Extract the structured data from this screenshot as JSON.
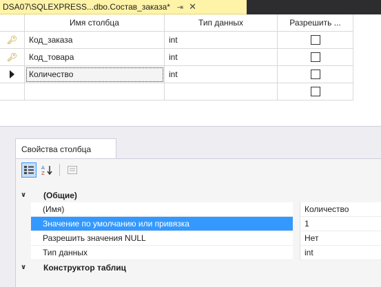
{
  "document_tab": {
    "title": "DSA07\\SQLEXPRESS...dbo.Состав_заказа*",
    "pin_icon": "pin-icon",
    "close_icon": "close-icon"
  },
  "grid": {
    "columns": [
      "Имя столбца",
      "Тип данных",
      "Разрешить ..."
    ],
    "rows": [
      {
        "indicator": "key-icon",
        "name": "Код_заказа",
        "type": "int",
        "allow_null": false
      },
      {
        "indicator": "key-icon",
        "name": "Код_товара",
        "type": "int",
        "allow_null": false
      },
      {
        "indicator": "current-row-arrow-icon",
        "name": "Количество",
        "type": "int",
        "allow_null": false
      },
      {
        "indicator": "",
        "name": "",
        "type": "",
        "allow_null": false
      }
    ]
  },
  "properties": {
    "tab_label": "Свойства столбца",
    "toolbar": [
      "categorized-icon",
      "alphabetical-icon",
      "property-pages-icon"
    ],
    "groups": [
      {
        "name": "(Общие)",
        "expanded": true,
        "items": [
          {
            "name": "(Имя)",
            "value": "Количество"
          },
          {
            "name": "Значение по умолчанию или привязка",
            "value": "1",
            "selected": true
          },
          {
            "name": "Разрешить значения NULL",
            "value": "Нет"
          },
          {
            "name": "Тип данных",
            "value": "int"
          }
        ]
      },
      {
        "name": "Конструктор таблиц",
        "expanded": true,
        "items": []
      }
    ]
  },
  "colors": {
    "tab_background": "#fff3a8",
    "selection": "#3399ff",
    "key": "#b48a00"
  }
}
